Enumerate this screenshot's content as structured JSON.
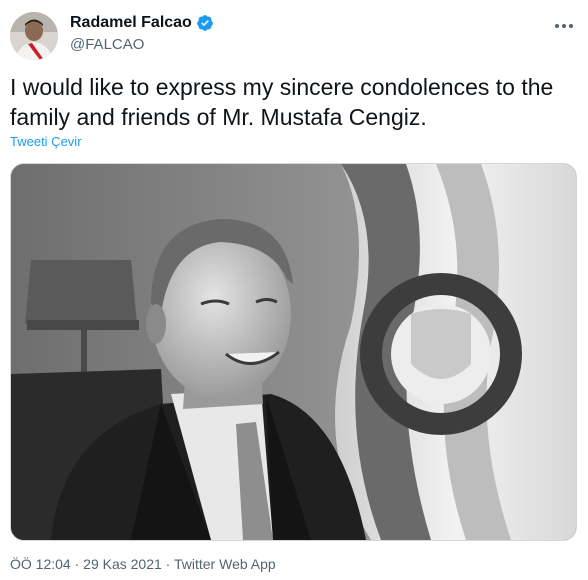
{
  "tweet": {
    "author_name": "Radamel Falcao",
    "author_handle": "@FALCAO",
    "text": "I would like to express my sincere condolences to the family and friends of Mr. Mustafa Cengiz.",
    "translate_label": "Tweeti Çevir",
    "time": "ÖÖ 12:04",
    "separator": "·",
    "date": "29 Kas 2021",
    "source": "Twitter Web App"
  },
  "icons": {
    "verified": "verified-badge-icon",
    "more": "more-options-icon"
  },
  "colors": {
    "verified": "#1d9bf0",
    "link": "#1d9bf0",
    "secondary_text": "#536471"
  }
}
